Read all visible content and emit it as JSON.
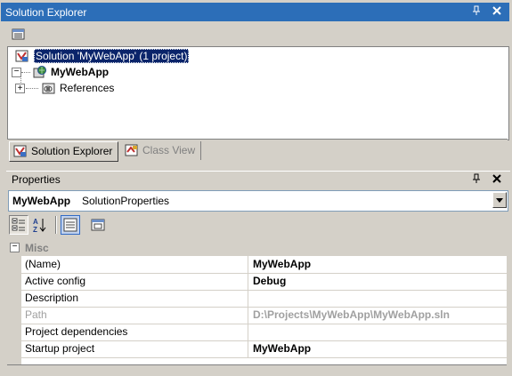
{
  "solution_explorer": {
    "title": "Solution Explorer",
    "pin_glyph": "▐",
    "close_glyph": "✕",
    "tree": [
      {
        "label": "Solution 'MyWebApp' (1 project)",
        "icon": "solution-icon",
        "selected": true
      },
      {
        "label": "MyWebApp",
        "icon": "web-project-icon",
        "expander": "−",
        "bold": true
      },
      {
        "label": "References",
        "icon": "references-icon",
        "expander": "+"
      }
    ],
    "tabs": [
      {
        "label": "Solution Explorer",
        "icon": "solution-explorer-tab-icon",
        "active": true
      },
      {
        "label": "Class View",
        "icon": "class-view-tab-icon",
        "active": false
      }
    ]
  },
  "properties": {
    "title": "Properties",
    "pin_glyph": "▐",
    "close_glyph": "✕",
    "object_name": "MyWebApp",
    "object_type": "SolutionProperties",
    "category": {
      "label": "Misc",
      "expander": "−"
    },
    "rows": [
      {
        "name": "(Name)",
        "value": "MyWebApp",
        "disabled": false
      },
      {
        "name": "Active config",
        "value": "Debug",
        "disabled": false
      },
      {
        "name": "Description",
        "value": "",
        "disabled": false
      },
      {
        "name": "Path",
        "value": "D:\\Projects\\MyWebApp\\MyWebApp.sln",
        "disabled": true
      },
      {
        "name": "Project dependencies",
        "value": "",
        "disabled": false
      },
      {
        "name": "Startup project",
        "value": "MyWebApp",
        "disabled": false
      }
    ]
  },
  "colors": {
    "title_bar": "#2c6eb8",
    "selection": "#0a246a",
    "disabled_text": "#a0a0a0"
  }
}
